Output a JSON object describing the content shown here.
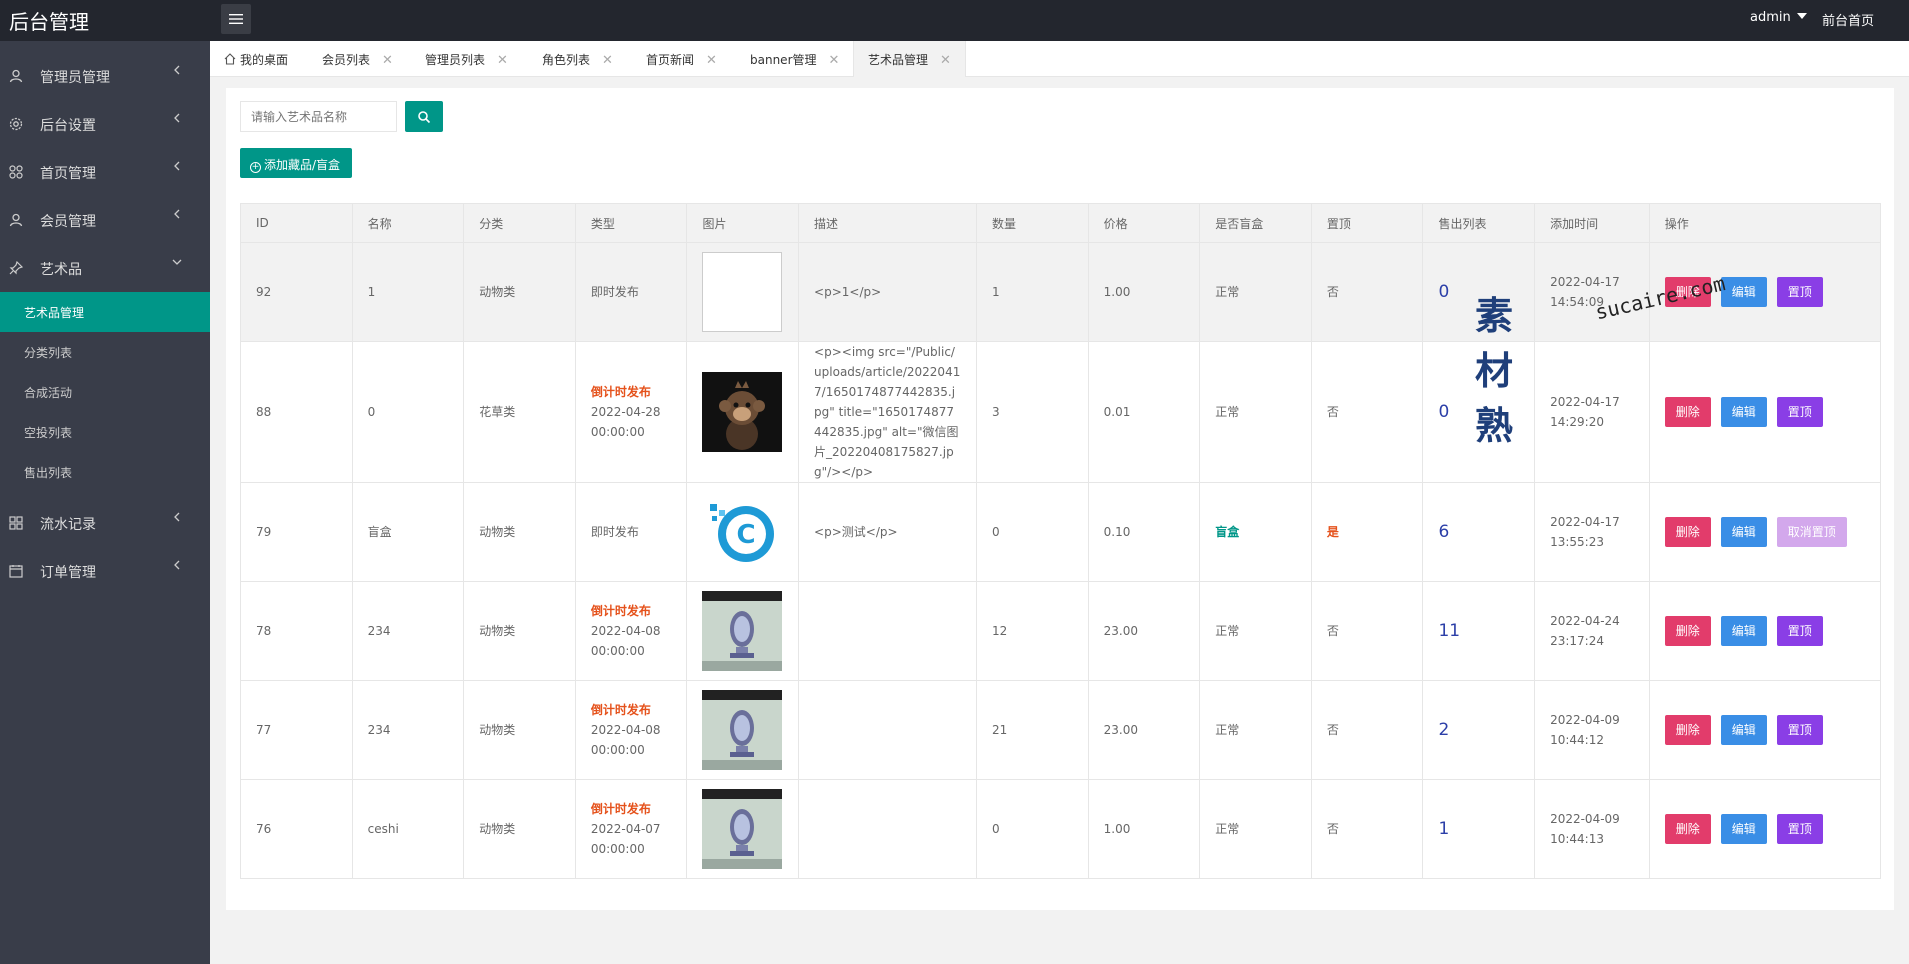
{
  "header": {
    "logo": "后台管理",
    "user": "admin",
    "front_link": "前台首页"
  },
  "sidebar": {
    "items": [
      {
        "label": "管理员管理"
      },
      {
        "label": "后台设置"
      },
      {
        "label": "首页管理"
      },
      {
        "label": "会员管理"
      },
      {
        "label": "艺术品"
      },
      {
        "label": "流水记录"
      },
      {
        "label": "订单管理"
      }
    ],
    "subitems": [
      {
        "label": "艺术品管理"
      },
      {
        "label": "分类列表"
      },
      {
        "label": "合成活动"
      },
      {
        "label": "空投列表"
      },
      {
        "label": "售出列表"
      }
    ]
  },
  "tabs": [
    {
      "label": "我的桌面"
    },
    {
      "label": "会员列表"
    },
    {
      "label": "管理员列表"
    },
    {
      "label": "角色列表"
    },
    {
      "label": "首页新闻"
    },
    {
      "label": "banner管理"
    },
    {
      "label": "艺术品管理"
    }
  ],
  "search": {
    "placeholder": "请输入艺术品名称"
  },
  "add_button": "添加藏品/盲盒",
  "table": {
    "headers": [
      "ID",
      "名称",
      "分类",
      "类型",
      "图片",
      "描述",
      "数量",
      "价格",
      "是否盲盒",
      "置顶",
      "售出列表",
      "添加时间",
      "操作"
    ],
    "rows": [
      {
        "id": "92",
        "name": "1",
        "category": "动物类",
        "type_label": "即时发布",
        "type_date": "",
        "image": "broken",
        "desc": "<p>1</p>",
        "qty": "1",
        "price": "1.00",
        "blind": "正常",
        "top": "否",
        "sold": "0",
        "time": "2022-04-17 14:54:09",
        "top_btn": "置顶"
      },
      {
        "id": "88",
        "name": "0",
        "category": "花草类",
        "type_label": "倒计时发布",
        "type_date": "2022-04-28 00:00:00",
        "image": "monkey",
        "desc": "<p><img src=\"/Public/uploads/article/20220417/1650174877442835.jpg\" title=\"1650174877442835.jpg\" alt=\"微信图片_20220408175827.jpg\"/></p>",
        "qty": "3",
        "price": "0.01",
        "blind": "正常",
        "top": "否",
        "sold": "0",
        "time": "2022-04-17 14:29:20",
        "top_btn": "置顶"
      },
      {
        "id": "79",
        "name": "盲盒",
        "category": "动物类",
        "type_label": "即时发布",
        "type_date": "",
        "image": "logo",
        "desc": "<p>测试</p>",
        "qty": "0",
        "price": "0.10",
        "blind": "盲盒",
        "top": "是",
        "sold": "6",
        "time": "2022-04-17 13:55:23",
        "top_btn": "取消置顶"
      },
      {
        "id": "78",
        "name": "234",
        "category": "动物类",
        "type_label": "倒计时发布",
        "type_date": "2022-04-08 00:00:00",
        "image": "mirror",
        "desc": "",
        "qty": "12",
        "price": "23.00",
        "blind": "正常",
        "top": "否",
        "sold": "11",
        "time": "2022-04-24 23:17:24",
        "top_btn": "置顶"
      },
      {
        "id": "77",
        "name": "234",
        "category": "动物类",
        "type_label": "倒计时发布",
        "type_date": "2022-04-08 00:00:00",
        "image": "mirror",
        "desc": "",
        "qty": "21",
        "price": "23.00",
        "blind": "正常",
        "top": "否",
        "sold": "2",
        "time": "2022-04-09 10:44:12",
        "top_btn": "置顶"
      },
      {
        "id": "76",
        "name": "ceshi",
        "category": "动物类",
        "type_label": "倒计时发布",
        "type_date": "2022-04-07 00:00:00",
        "image": "mirror",
        "desc": "",
        "qty": "0",
        "price": "1.00",
        "blind": "正常",
        "top": "否",
        "sold": "1",
        "time": "2022-04-09 10:44:13",
        "top_btn": "置顶"
      }
    ],
    "buttons": {
      "delete": "删除",
      "edit": "编辑"
    }
  },
  "watermark": {
    "cn": "素材熟",
    "en": "sucaire.com"
  },
  "colors": {
    "accent": "#009688",
    "header": "#23262e",
    "sidebar": "#393d49",
    "delete": "#e23c6b",
    "edit": "#3a8ee6",
    "top": "#8a3ee6"
  }
}
